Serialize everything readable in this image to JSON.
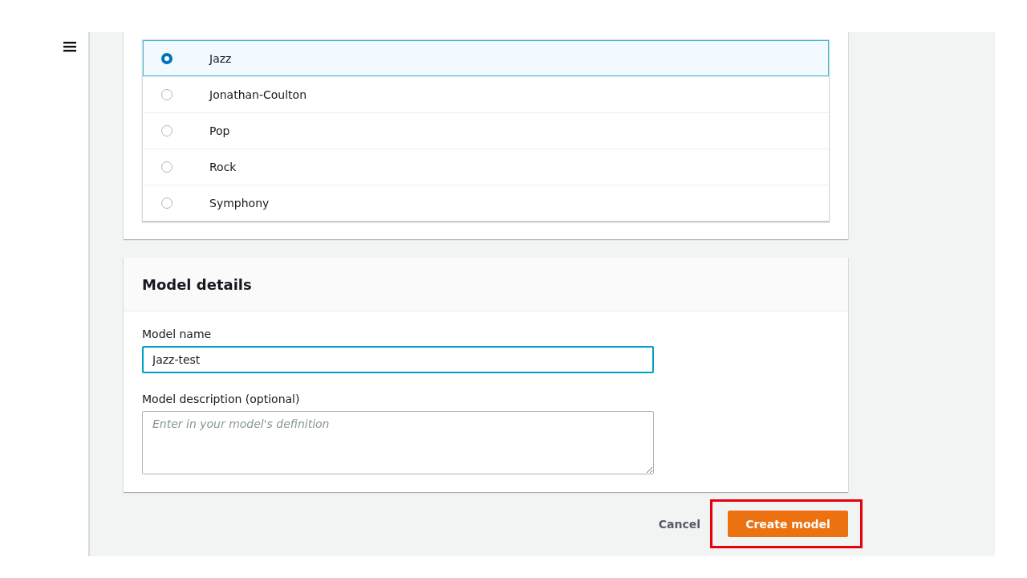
{
  "options": [
    {
      "label": "Jazz",
      "selected": true
    },
    {
      "label": "Jonathan-Coulton",
      "selected": false
    },
    {
      "label": "Pop",
      "selected": false
    },
    {
      "label": "Rock",
      "selected": false
    },
    {
      "label": "Symphony",
      "selected": false
    }
  ],
  "model_details": {
    "title": "Model details",
    "name_field": {
      "label": "Model name",
      "value": "Jazz-test"
    },
    "description_field": {
      "label": "Model description (optional)",
      "placeholder": "Enter in your model's definition"
    }
  },
  "actions": {
    "cancel": "Cancel",
    "create": {
      "label": "Create model",
      "highlighted": true
    }
  }
}
